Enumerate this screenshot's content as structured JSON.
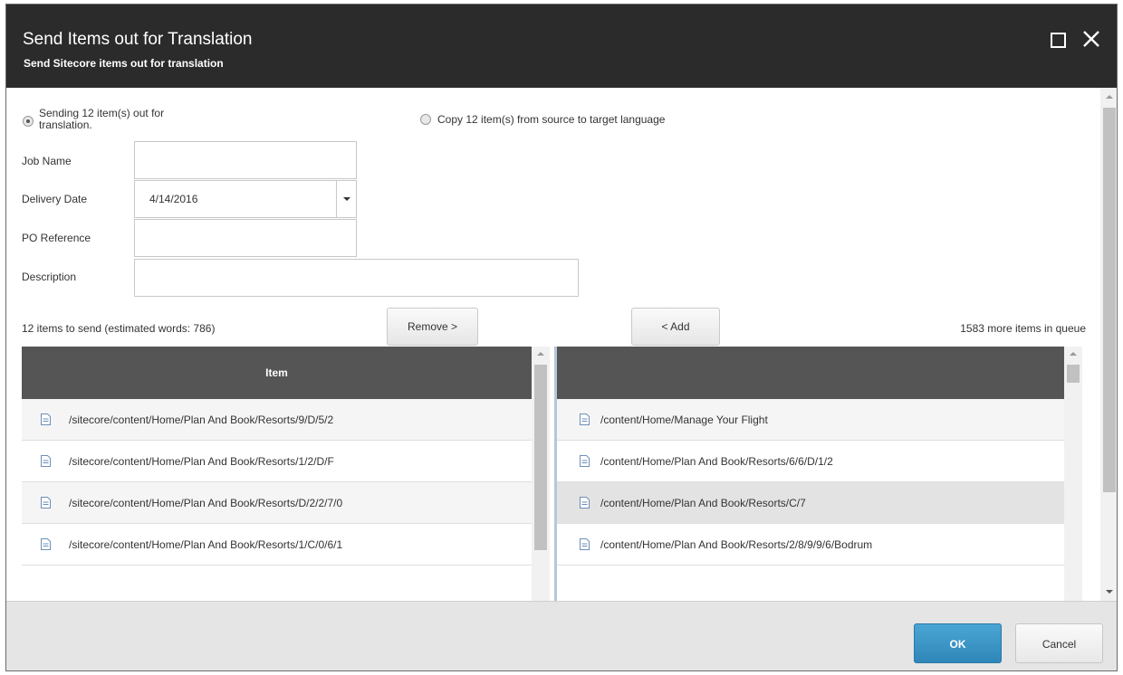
{
  "dialog": {
    "title": "Send Items out for Translation",
    "subtitle": "Send Sitecore items out for translation"
  },
  "options": {
    "send_label": "Sending 12 item(s) out for translation.",
    "copy_label": "Copy 12 item(s) from source to target language"
  },
  "form": {
    "job_name_label": "Job Name",
    "job_name_value": "",
    "delivery_date_label": "Delivery Date",
    "delivery_date_value": "4/14/2016",
    "po_reference_label": "PO Reference",
    "po_reference_value": "",
    "description_label": "Description",
    "description_value": ""
  },
  "transfer": {
    "count_text": "12 items to send (estimated words: 786)",
    "remove_label": "Remove >",
    "add_label": "< Add",
    "queue_text": "1583 more items in queue"
  },
  "left_list": {
    "header": "Item",
    "items": [
      "/sitecore/content/Home/Plan And Book/Resorts/9/D/5/2",
      "/sitecore/content/Home/Plan And Book/Resorts/1/2/D/F",
      "/sitecore/content/Home/Plan And Book/Resorts/D/2/2/7/0",
      "/sitecore/content/Home/Plan And Book/Resorts/1/C/0/6/1"
    ]
  },
  "right_list": {
    "header": "",
    "items": [
      "/content/Home/Manage Your Flight",
      "/content/Home/Plan And Book/Resorts/6/6/D/1/2",
      "/content/Home/Plan And Book/Resorts/C/7",
      "/content/Home/Plan And Book/Resorts/2/8/9/9/6/Bodrum"
    ],
    "selected_index": 2
  },
  "footer": {
    "ok_label": "OK",
    "cancel_label": "Cancel"
  },
  "icons": {
    "maximize": "maximize-icon",
    "close": "close-icon",
    "document": "document-icon"
  },
  "colors": {
    "header_bg": "#2b2b2b",
    "list_header_bg": "#555555",
    "ok_button": "#3a96c6"
  }
}
